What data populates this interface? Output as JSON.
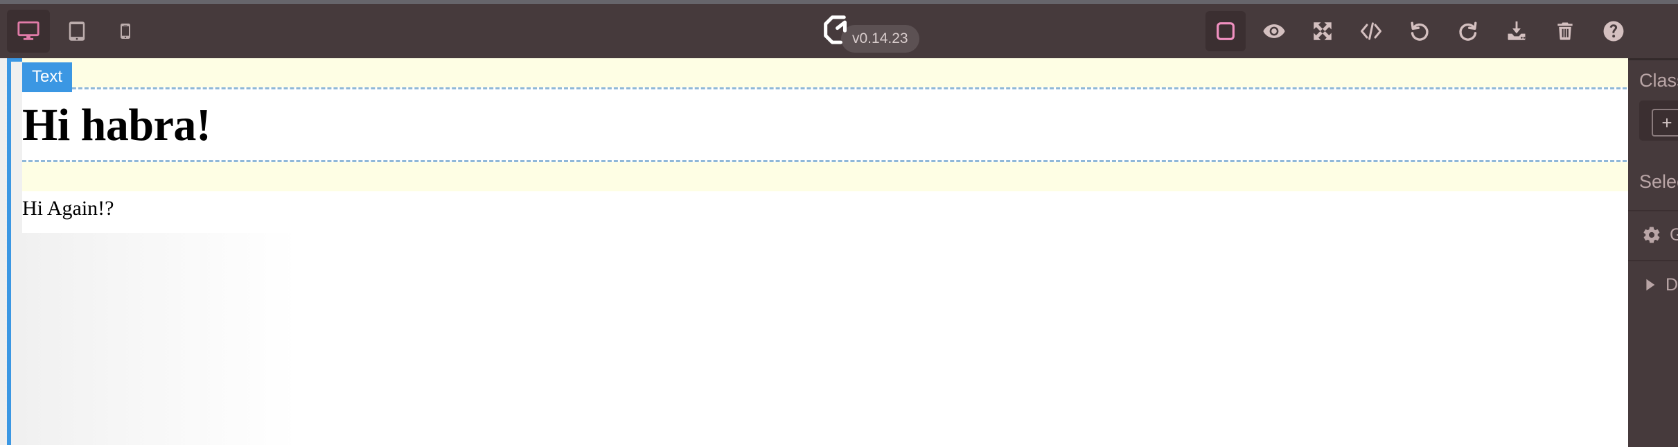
{
  "app": {
    "name": "GrapesJS",
    "version_badge": "v0.14.23"
  },
  "topbar": {
    "devices": [
      {
        "name": "desktop",
        "label": "Desktop",
        "icon": "desktop-icon",
        "active": true
      },
      {
        "name": "tablet",
        "label": "Tablet",
        "icon": "tablet-icon",
        "active": false
      },
      {
        "name": "mobile",
        "label": "Mobile",
        "icon": "mobile-icon",
        "active": false
      }
    ],
    "actions": [
      {
        "name": "borders",
        "label": "View components",
        "icon": "square-outline-icon",
        "active": true
      },
      {
        "name": "preview",
        "label": "Preview",
        "icon": "eye-icon",
        "active": false
      },
      {
        "name": "fullscreen",
        "label": "Fullscreen",
        "icon": "fullscreen-arrows-icon",
        "active": false
      },
      {
        "name": "export-code",
        "label": "Export code",
        "icon": "code-brackets-icon",
        "active": false
      },
      {
        "name": "undo",
        "label": "Undo",
        "icon": "undo-arrow-icon",
        "active": false
      },
      {
        "name": "redo",
        "label": "Redo",
        "icon": "redo-arrow-icon",
        "active": false
      },
      {
        "name": "import",
        "label": "Import",
        "icon": "download-tray-icon",
        "active": false
      },
      {
        "name": "clear-canvas",
        "label": "Clear canvas",
        "icon": "trash-icon",
        "active": false
      },
      {
        "name": "help",
        "label": "Help",
        "icon": "question-circle-icon",
        "active": false
      }
    ],
    "colors": {
      "bar_bg": "#463a3c",
      "accent_pink": "#e07ba8",
      "icon": "#d4c0c0",
      "strip": "#66656b"
    }
  },
  "canvas": {
    "selected_badge": "Text",
    "heading": "Hi habra!",
    "paragraph": "Hi Again!?",
    "colors": {
      "selection_blue": "#3b97e3",
      "highlight_yellow": "#fefee4",
      "dashed_border": "#8fb8d8",
      "page_bg": "#ffffff"
    }
  },
  "right_panel": {
    "classes_label": "Classes",
    "add_class_symbol": "+",
    "selected_label": "Selected",
    "sectors": [
      {
        "name": "general",
        "label": "General",
        "icon": "gear-icon"
      },
      {
        "name": "dimension",
        "label": "Dimension",
        "icon": "caret-right-icon"
      }
    ]
  }
}
